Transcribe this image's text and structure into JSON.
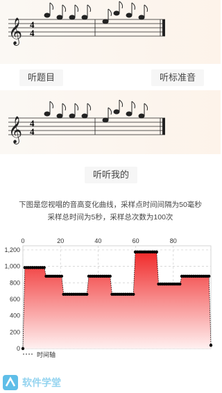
{
  "buttons": {
    "listen_question": "听题目",
    "listen_standard": "听标准音",
    "listen_mine": "听听我的"
  },
  "caption": {
    "line1": "下图是您视唱的音高变化曲线，采样点时间间隔为50毫秒",
    "line2": "采样总时间为5秒，采样总次数为100次"
  },
  "staff": {
    "time_signature_top": "4",
    "time_signature_bottom": "4",
    "clef": "𝄞"
  },
  "colors": {
    "fill_top": "#f02a2a",
    "fill_bottom": "#fff0f0",
    "point": "#000000",
    "grid": "#cccccc"
  },
  "chart_data": {
    "type": "area",
    "x_ticks": [
      0,
      20,
      40,
      60,
      80
    ],
    "y_ticks": [
      "0",
      "200",
      "400",
      "600",
      "800",
      "1,000",
      "1,200"
    ],
    "xlim": [
      0,
      100
    ],
    "ylim": [
      0,
      1250
    ],
    "legend": "时间轴",
    "grid": true,
    "series": [
      {
        "values": [
          0,
          985,
          985,
          985,
          985,
          985,
          985,
          985,
          985,
          985,
          985,
          985,
          880,
          880,
          880,
          880,
          880,
          880,
          880,
          880,
          880,
          660,
          660,
          660,
          660,
          660,
          660,
          660,
          660,
          660,
          660,
          660,
          660,
          660,
          880,
          880,
          880,
          880,
          880,
          880,
          880,
          880,
          880,
          880,
          880,
          880,
          660,
          660,
          660,
          660,
          660,
          660,
          660,
          660,
          660,
          660,
          660,
          660,
          1175,
          1175,
          1175,
          1175,
          1175,
          1175,
          1175,
          1175,
          1175,
          1175,
          1175,
          1175,
          785,
          785,
          785,
          785,
          785,
          785,
          785,
          785,
          785,
          785,
          785,
          785,
          880,
          880,
          880,
          880,
          880,
          880,
          880,
          880,
          880,
          880,
          880,
          880,
          880,
          880,
          880,
          40
        ]
      }
    ]
  }
}
